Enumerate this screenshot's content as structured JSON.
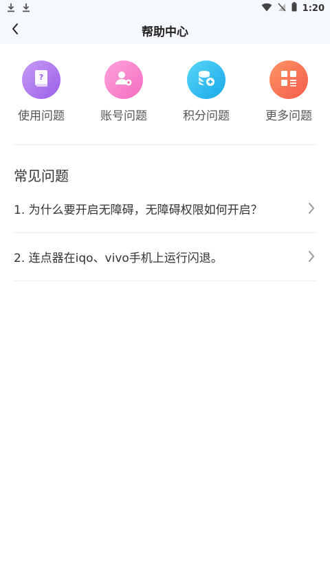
{
  "status_bar": {
    "time": "1:20",
    "icons": [
      "download-icon",
      "download-icon",
      "wifi-icon",
      "signal-off-icon",
      "battery-icon"
    ]
  },
  "header": {
    "title": "帮助中心",
    "back_icon": "chevron-left-icon"
  },
  "categories": [
    {
      "label": "使用问题",
      "icon": "question-book-icon",
      "color_from": "#c28bf2",
      "color_to": "#9a5fe8"
    },
    {
      "label": "账号问题",
      "icon": "user-gear-icon",
      "color_from": "#ff9ad6",
      "color_to": "#f36bc0"
    },
    {
      "label": "积分问题",
      "icon": "coin-stack-icon",
      "color_from": "#4fd0f5",
      "color_to": "#1aa8ea"
    },
    {
      "label": "更多问题",
      "icon": "grid-more-icon",
      "color_from": "#ff8a5c",
      "color_to": "#f45b4b"
    }
  ],
  "faq": {
    "section_title": "常见问题",
    "items": [
      {
        "text": "1. 为什么要开启无障碍，无障碍权限如何开启？"
      },
      {
        "text": "2. 连点器在iqo、vivo手机上运行闪退。"
      }
    ]
  }
}
